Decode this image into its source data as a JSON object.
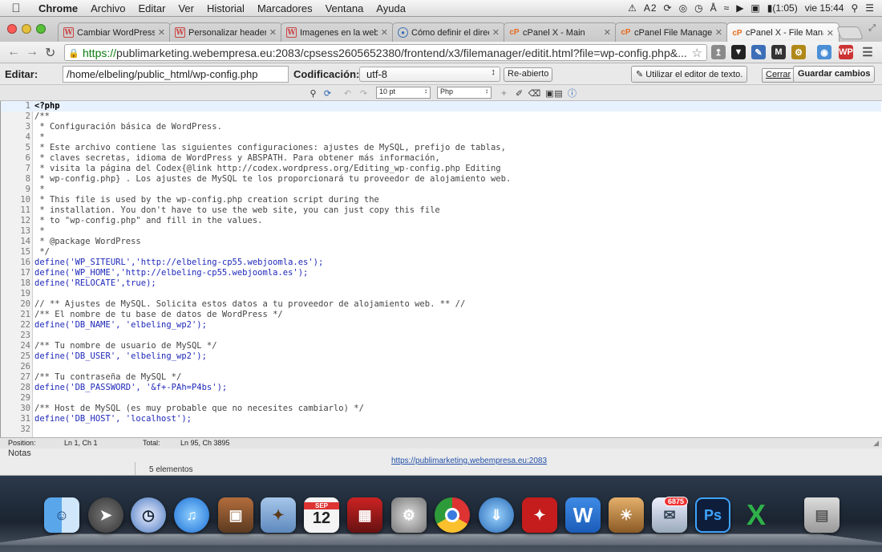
{
  "menubar": {
    "app": "Chrome",
    "items": [
      "Archivo",
      "Editar",
      "Ver",
      "Historial",
      "Marcadores",
      "Ventana",
      "Ayuda"
    ],
    "status": {
      "drive_badge": "2",
      "battery": "(1:05)",
      "clock": "vie 15:44"
    }
  },
  "tabs": [
    {
      "title": "Cambiar WordPress",
      "favicon": "wordpress-icon",
      "active": false
    },
    {
      "title": "Personalizar header",
      "favicon": "wordpress-icon",
      "active": false
    },
    {
      "title": "Imagenes en la web",
      "favicon": "wordpress-icon",
      "active": false
    },
    {
      "title": "Cómo definir el direc",
      "favicon": "globe-icon",
      "active": false
    },
    {
      "title": "cPanel X - Main",
      "favicon": "cpanel-icon",
      "active": false
    },
    {
      "title": "cPanel File Manager",
      "favicon": "cpanel-icon",
      "active": false
    },
    {
      "title": "cPanel X - File Mana",
      "favicon": "cpanel-icon",
      "active": true
    }
  ],
  "omnibox": {
    "scheme": "https://",
    "url": "publimarketing.webempresa.eu:2083/cpsess2605652380/frontend/x3/filemanager/editit.html?file=wp-config.php&..."
  },
  "editor": {
    "edit_label": "Editar:",
    "path": "/home/elbeling/public_html/wp-config.php",
    "encoding_label": "Codificación:",
    "encoding": "utf-8",
    "reopen": "Re-abierto",
    "use_text_editor": "Utilizar el editor de texto.",
    "cancel": "Cerrar",
    "save": "Guardar cambios",
    "font_size": "10 pt",
    "syntax": "Php"
  },
  "code_lines": [
    {
      "n": "1",
      "text": "<?php",
      "kind": "php"
    },
    {
      "n": "2",
      "text": "/**",
      "kind": "cmt"
    },
    {
      "n": "3",
      "text": " * Configuración básica de WordPress.",
      "kind": "cmt"
    },
    {
      "n": "4",
      "text": " *",
      "kind": "cmt"
    },
    {
      "n": "5",
      "text": " * Este archivo contiene las siguientes configuraciones: ajustes de MySQL, prefijo de tablas,",
      "kind": "cmt"
    },
    {
      "n": "6",
      "text": " * claves secretas, idioma de WordPress y ABSPATH. Para obtener más información,",
      "kind": "cmt"
    },
    {
      "n": "7",
      "text": " * visita la página del Codex{@link http://codex.wordpress.org/Editing_wp-config.php Editing",
      "kind": "cmt"
    },
    {
      "n": "8",
      "text": " * wp-config.php} . Los ajustes de MySQL te los proporcionará tu proveedor de alojamiento web.",
      "kind": "cmt"
    },
    {
      "n": "9",
      "text": " *",
      "kind": "cmt"
    },
    {
      "n": "10",
      "text": " * This file is used by the wp-config.php creation script during the",
      "kind": "cmt"
    },
    {
      "n": "11",
      "text": " * installation. You don't have to use the web site, you can just copy this file",
      "kind": "cmt"
    },
    {
      "n": "12",
      "text": " * to \"wp-config.php\" and fill in the values.",
      "kind": "cmt"
    },
    {
      "n": "13",
      "text": " *",
      "kind": "cmt"
    },
    {
      "n": "14",
      "text": " * @package WordPress",
      "kind": "cmt"
    },
    {
      "n": "15",
      "text": " */",
      "kind": "cmt"
    },
    {
      "n": "16",
      "text": "define('WP_SITEURL','http://elbeling-cp55.webjoomla.es');",
      "kind": "fn"
    },
    {
      "n": "17",
      "text": "define('WP_HOME','http://elbeling-cp55.webjoomla.es');",
      "kind": "fn"
    },
    {
      "n": "18",
      "text": "define('RELOCATE',true);",
      "kind": "fn"
    },
    {
      "n": "19",
      "text": "",
      "kind": "cmt"
    },
    {
      "n": "20",
      "text": "// ** Ajustes de MySQL. Solicita estos datos a tu proveedor de alojamiento web. ** //",
      "kind": "cmt"
    },
    {
      "n": "21",
      "text": "/** El nombre de tu base de datos de WordPress */",
      "kind": "cmt"
    },
    {
      "n": "22",
      "text": "define('DB_NAME', 'elbeling_wp2');",
      "kind": "fn"
    },
    {
      "n": "23",
      "text": "",
      "kind": "cmt"
    },
    {
      "n": "24",
      "text": "/** Tu nombre de usuario de MySQL */",
      "kind": "cmt"
    },
    {
      "n": "25",
      "text": "define('DB_USER', 'elbeling_wp2');",
      "kind": "fn"
    },
    {
      "n": "26",
      "text": "",
      "kind": "cmt"
    },
    {
      "n": "27",
      "text": "/** Tu contraseña de MySQL */",
      "kind": "cmt"
    },
    {
      "n": "28",
      "text": "define('DB_PASSWORD', '&f+-PAh=P4bs');",
      "kind": "fn"
    },
    {
      "n": "29",
      "text": "",
      "kind": "cmt"
    },
    {
      "n": "30",
      "text": "/** Host de MySQL (es muy probable que no necesites cambiarlo) */",
      "kind": "cmt"
    },
    {
      "n": "31",
      "text": "define('DB_HOST', 'localhost');",
      "kind": "fn"
    },
    {
      "n": "32",
      "text": "",
      "kind": "cmt"
    }
  ],
  "statusbar": {
    "position_label": "Position:",
    "position": "Ln 1, Ch 1",
    "total_label": "Total:",
    "total": "Ln 95, Ch 3895"
  },
  "background_window": {
    "notes": "Notas",
    "count": "5 elementos",
    "link": "https://publimarketing.webempresa.eu:2083"
  },
  "dock": {
    "calendar_month": "SEP",
    "calendar_day": "12",
    "mail_badge": "6875",
    "apps": [
      "finder-icon",
      "launchpad-icon",
      "alarm-clock-icon",
      "itunes-icon",
      "photo-browser-icon",
      "preview-icon",
      "calendar-icon",
      "movie-icon",
      "system-preferences-icon",
      "chrome-icon",
      "network-icon",
      "acrobat-icon",
      "word-icon",
      "iphoto-icon",
      "mail-icon",
      "photoshop-icon",
      "excel-icon",
      "trash-icon"
    ]
  }
}
